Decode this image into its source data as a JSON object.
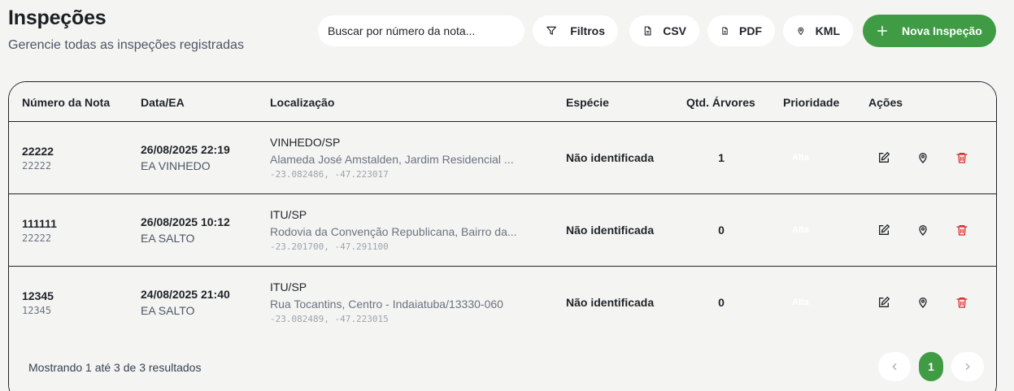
{
  "header": {
    "title": "Inspeções",
    "subtitle": "Gerencie todas as inspeções registradas"
  },
  "toolbar": {
    "search_placeholder": "Buscar por número da nota...",
    "filters_label": "Filtros",
    "csv_label": "CSV",
    "pdf_label": "PDF",
    "kml_label": "KML",
    "new_label": "Nova Inspeção",
    "accent_color": "#3f9c45"
  },
  "table": {
    "columns": [
      "Número da Nota",
      "Data/EA",
      "Localização",
      "Espécie",
      "Qtd. Árvores",
      "Prioridade",
      "Ações"
    ],
    "rows": [
      {
        "nota": "22222",
        "nota_sub": "22222",
        "date": "26/08/2025 22:19",
        "ea": "EA VINHEDO",
        "city": "VINHEDO/SP",
        "address": "Alameda José Amstalden, Jardim Residencial ...",
        "coords": "-23.082486, -47.223017",
        "especie": "Não identificada",
        "qtd": "1",
        "prioridade": "Alta"
      },
      {
        "nota": "111111",
        "nota_sub": "22222",
        "date": "26/08/2025 10:12",
        "ea": "EA SALTO",
        "city": "ITU/SP",
        "address": "Rodovia da Convenção Republicana, Bairro da...",
        "coords": "-23.201700, -47.291100",
        "especie": "Não identificada",
        "qtd": "0",
        "prioridade": "Alta"
      },
      {
        "nota": "12345",
        "nota_sub": "12345",
        "date": "24/08/2025 21:40",
        "ea": "EA SALTO",
        "city": "ITU/SP",
        "address": "Rua Tocantins, Centro - Indaiatuba/13330-060",
        "coords": "-23.082489, -47.223015",
        "especie": "Não identificada",
        "qtd": "0",
        "prioridade": "Alta"
      }
    ]
  },
  "footer": {
    "showing": "Mostrando 1 até 3 de 3 resultados",
    "current_page": "1"
  },
  "icons": {
    "edit": "edit-icon",
    "map": "map-pin-icon",
    "delete": "trash-icon",
    "delete_color": "#dc2626"
  }
}
